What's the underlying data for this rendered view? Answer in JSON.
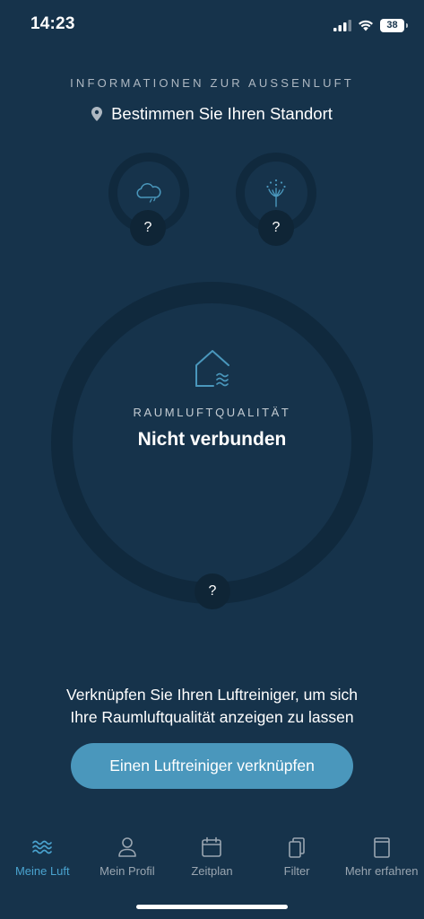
{
  "status_bar": {
    "time": "14:23",
    "battery": "38"
  },
  "outdoor": {
    "title": "INFORMATIONEN ZUR AUSSENLUFT",
    "location_label": "Bestimmen Sie Ihren Standort",
    "weather_value": "?",
    "pollen_value": "?"
  },
  "room": {
    "label": "RAUMLUFTQUALITÄT",
    "status": "Nicht verbunden",
    "value": "?"
  },
  "connect": {
    "description_line1": "Verknüpfen Sie Ihren Luftreiniger, um sich",
    "description_line2": "Ihre Raumluftqualität anzeigen zu lassen",
    "button_label": "Einen Luftreiniger verknüpfen"
  },
  "tabs": [
    {
      "label": "Meine Luft",
      "icon": "waves-icon",
      "active": true
    },
    {
      "label": "Mein Profil",
      "icon": "person-icon",
      "active": false
    },
    {
      "label": "Zeitplan",
      "icon": "calendar-icon",
      "active": false
    },
    {
      "label": "Filter",
      "icon": "filter-icon",
      "active": false
    },
    {
      "label": "Mehr erfahren",
      "icon": "book-icon",
      "active": false
    }
  ],
  "colors": {
    "background": "#16334b",
    "ring": "#10293d",
    "accent": "#4a97bc",
    "active_tab": "#4aa3cf"
  }
}
